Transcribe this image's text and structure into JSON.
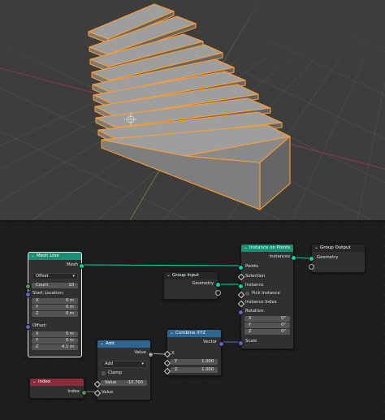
{
  "nodes": {
    "mesh_line": {
      "title": "Mesh Line",
      "out_mesh": "Mesh",
      "mode": "Offset",
      "count_label": "Count",
      "count_value": "10",
      "start_label": "Start Location:",
      "start": [
        {
          "axis": "X",
          "value": "0 m"
        },
        {
          "axis": "Y",
          "value": "0 m"
        },
        {
          "axis": "Z",
          "value": "0 m"
        }
      ],
      "offset_label": "Offset:",
      "offset": [
        {
          "axis": "X",
          "value": "0 m"
        },
        {
          "axis": "Y",
          "value": "0 m"
        },
        {
          "axis": "Z",
          "value": "4.1 m"
        }
      ]
    },
    "group_input": {
      "title": "Group Input",
      "out_geometry": "Geometry"
    },
    "instance_on_points": {
      "title": "Instance on Points",
      "out_instances": "Instances",
      "points": "Points",
      "selection": "Selection",
      "instance": "Instance",
      "pick_instance": "Pick Instance",
      "instance_index": "Instance Index",
      "rotation_label": "Rotation:",
      "rotation": [
        {
          "axis": "X",
          "value": "0°"
        },
        {
          "axis": "Y",
          "value": "0°"
        },
        {
          "axis": "Z",
          "value": "0°"
        }
      ],
      "scale": "Scale"
    },
    "group_output": {
      "title": "Group Output",
      "in_geometry": "Geometry"
    },
    "add": {
      "title": "Add",
      "out_value": "Value",
      "operation": "Add",
      "clamp": "Clamp",
      "value_label": "Value",
      "value": "-10.700",
      "in_value": "Value"
    },
    "combine_xyz": {
      "title": "Combine XYZ",
      "out_vector": "Vector",
      "x": "X",
      "y_label": "Y",
      "y_value": "1.000",
      "z_label": "Z",
      "z_value": "1.000"
    },
    "index": {
      "title": "Index",
      "out_index": "Index"
    }
  },
  "colors": {
    "geometry_header": "#1b8f73",
    "utility_header": "#2c6691",
    "input_header": "#8c2b3b",
    "selection_outline": "#ff9d2e",
    "geometry_socket": "#00d6a3",
    "vector_socket": "#6363c7",
    "float_socket": "#a1a1a1",
    "integer_socket": "#598c5c"
  }
}
